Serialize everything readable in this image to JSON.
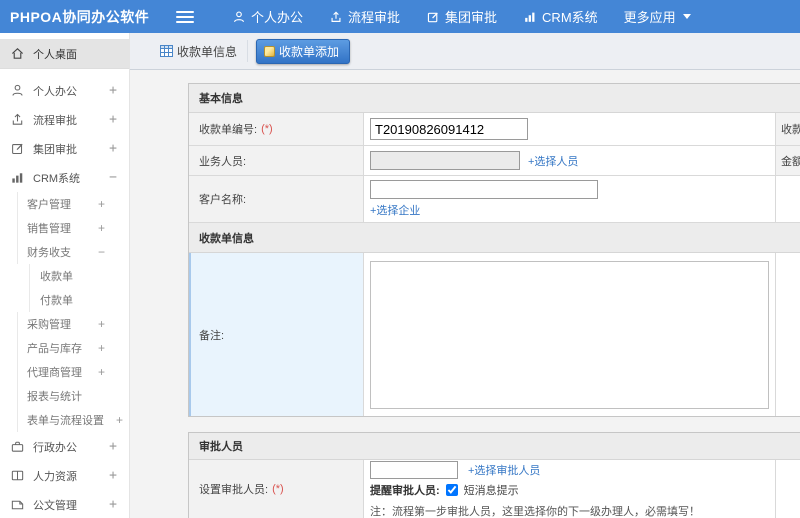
{
  "topbar": {
    "logo": "PHPOA协同办公软件",
    "menu": [
      {
        "label": "个人办公",
        "icon": "user-icon"
      },
      {
        "label": "流程审批",
        "icon": "flow-icon"
      },
      {
        "label": "集团审批",
        "icon": "edit-square-icon"
      },
      {
        "label": "CRM系统",
        "icon": "bar-chart-icon"
      },
      {
        "label": "更多应用",
        "icon": "caret-down-icon"
      }
    ]
  },
  "sidebar": {
    "items": [
      {
        "label": "个人桌面",
        "expander": "",
        "icon": "home-icon",
        "level": 1,
        "selected": true
      },
      {
        "label": "个人办公",
        "expander": "+",
        "icon": "user-icon",
        "level": 1
      },
      {
        "label": "流程审批",
        "expander": "+",
        "icon": "flow-icon",
        "level": 1
      },
      {
        "label": "集团审批",
        "expander": "+",
        "icon": "edit-square-icon",
        "level": 1
      },
      {
        "label": "CRM系统",
        "expander": "−",
        "icon": "bar-chart-icon",
        "level": 1,
        "expanded": true
      },
      {
        "label": "客户管理",
        "expander": "+",
        "level": 2
      },
      {
        "label": "销售管理",
        "expander": "+",
        "level": 2
      },
      {
        "label": "财务收支",
        "expander": "−",
        "level": 2,
        "expanded": true
      },
      {
        "label": "收款单",
        "expander": "",
        "level": 3
      },
      {
        "label": "付款单",
        "expander": "",
        "level": 3
      },
      {
        "label": "采购管理",
        "expander": "+",
        "level": 2
      },
      {
        "label": "产品与库存",
        "expander": "+",
        "level": 2
      },
      {
        "label": "代理商管理",
        "expander": "+",
        "level": 2
      },
      {
        "label": "报表与统计",
        "expander": "",
        "level": 2
      },
      {
        "label": "表单与流程设置",
        "expander": "+",
        "level": 2
      },
      {
        "label": "行政办公",
        "expander": "+",
        "icon": "briefcase-icon",
        "level": 1
      },
      {
        "label": "人力资源",
        "expander": "+",
        "icon": "book-icon",
        "level": 1
      },
      {
        "label": "公文管理",
        "expander": "+",
        "icon": "document-icon",
        "level": 1
      }
    ]
  },
  "tabs": {
    "info_tab": "收款单信息",
    "add_tab": "收款单添加"
  },
  "form": {
    "basic": {
      "title": "基本信息",
      "receipt_no_label": "收款单编号:",
      "receipt_no_required": "(*)",
      "receipt_no_value": "T20190826091412",
      "salesperson_label": "业务人员:",
      "choose_person_link": "+选择人员",
      "customer_label": "客户名称:",
      "choose_company_link": "+选择企业",
      "date_label": "收款单日期:",
      "amount_label": "金额:"
    },
    "receipt_info": {
      "title": "收款单信息",
      "remark_label": "备注:"
    },
    "approval": {
      "title": "审批人员",
      "set_approver_label": "设置审批人员:",
      "set_approver_required": "(*)",
      "choose_approver_link": "+选择审批人员",
      "remind_label": "提醒审批人员:",
      "sms_label": "短消息提示",
      "sms_checked": "checked",
      "note": "注：流程第一步审批人员，这里选择你的下一级办理人，必需填写！"
    }
  },
  "colors": {
    "topbar_blue": "#4486d6",
    "link_blue": "#3677c5",
    "tab_button_blue": "#3a7cc9",
    "required_red": "#d9534f",
    "remark_highlight": "#e9f4fd"
  }
}
